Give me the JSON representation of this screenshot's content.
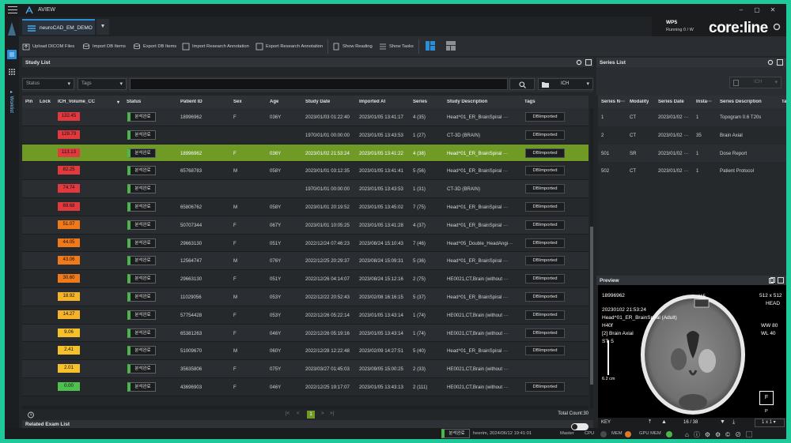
{
  "window": {
    "title": "AVIEW"
  },
  "project": {
    "name": "neuroCAD_EM_DEMO"
  },
  "wp5": {
    "title": "WP5",
    "status_text": "Running 0 / W",
    "brand_text": "core:line"
  },
  "toolbar": {
    "upload": "Upload DICOM Files",
    "import_db": "Import DB Items",
    "export_db": "Export DB Items",
    "import_research": "Import Research Annotation",
    "export_research": "Export Research Annotation",
    "show_reading": "Show Reading",
    "show_tasks": "Show Tasks"
  },
  "study_list": {
    "title": "Study List",
    "filters": {
      "status": "Status",
      "tags": "Tags",
      "search_value": "",
      "view_mode": "ICH"
    },
    "columns": {
      "pin": "Pin",
      "lock": "Lock",
      "ich": "ICH_Volume_CC",
      "status": "Status",
      "patient_id": "Patient ID",
      "sex": "Sex",
      "age": "Age",
      "study_date": "Study Date",
      "imported_at": "Imported At",
      "series": "Series",
      "description": "Study Description",
      "tags": "Tags"
    },
    "rows": [
      {
        "ich": "132.45",
        "color": "#e0393e",
        "status": "분석완료",
        "patient_id": "18996962",
        "sex": "F",
        "age": "036Y",
        "study_date": "2023/01/03 01:22:40",
        "imported_at": "2023/01/05 13:41:17",
        "series": "4 (35)",
        "description": "Head^01_ER_BrainSpiral ···",
        "tag": "DBImported"
      },
      {
        "ich": "129.79",
        "color": "#e0393e",
        "status": "분석완료",
        "patient_id": "",
        "sex": "",
        "age": "",
        "study_date": "1970/01/01 00:00:00",
        "imported_at": "2023/01/05 13:43:53",
        "series": "1 (27)",
        "description": "CT-3D (BRAIN)",
        "tag": "DBImported"
      },
      {
        "ich": "113.13",
        "color": "#e0393e",
        "status": "분석완료",
        "patient_id": "18996962",
        "sex": "F",
        "age": "036Y",
        "study_date": "2023/01/02 21:53:24",
        "imported_at": "2023/01/05 13:41:22",
        "series": "4 (38)",
        "description": "Head^01_ER_BrainSpiral ···",
        "tag": "DBImported",
        "selected": true
      },
      {
        "ich": "82.25",
        "color": "#e0393e",
        "status": "분석완료",
        "patient_id": "65768783",
        "sex": "M",
        "age": "058Y",
        "study_date": "2023/01/01 03:12:35",
        "imported_at": "2023/01/05 13:41:41",
        "series": "5 (56)",
        "description": "Head^01_ER_BrainSpiral ···",
        "tag": "DBImported"
      },
      {
        "ich": "74.74",
        "color": "#e0393e",
        "status": "분석완료",
        "patient_id": "",
        "sex": "",
        "age": "",
        "study_date": "1970/01/01 00:00:00",
        "imported_at": "2023/01/05 13:43:53",
        "series": "1 (31)",
        "description": "CT-3D (BRAIN)",
        "tag": "DBImported"
      },
      {
        "ich": "69.68",
        "color": "#e0393e",
        "status": "분석완료",
        "patient_id": "65806762",
        "sex": "M",
        "age": "058Y",
        "study_date": "2023/01/01 20:19:52",
        "imported_at": "2023/01/05 13:45:02",
        "series": "7 (75)",
        "description": "Head^01_ER_BrainSpiral ···",
        "tag": "DBImported"
      },
      {
        "ich": "51.07",
        "color": "#f07a1a",
        "status": "분석완료",
        "patient_id": "50707344",
        "sex": "F",
        "age": "067Y",
        "study_date": "2023/01/01 10:05:25",
        "imported_at": "2023/01/05 13:41:28",
        "series": "4 (37)",
        "description": "Head^01_ER_BrainSpiral ···",
        "tag": "DBImported"
      },
      {
        "ich": "44.05",
        "color": "#f07a1a",
        "status": "분석완료",
        "patient_id": "29663130",
        "sex": "F",
        "age": "051Y",
        "study_date": "2022/12/24 07:46:23",
        "imported_at": "2023/08/24 15:10:43",
        "series": "7 (46)",
        "description": "Head^05_Double_HeadAngi···",
        "tag": "DBImported"
      },
      {
        "ich": "43.06",
        "color": "#f07a1a",
        "status": "분석완료",
        "patient_id": "12564747",
        "sex": "M",
        "age": "076Y",
        "study_date": "2022/12/25 20:29:37",
        "imported_at": "2023/08/24 15:09:31",
        "series": "5 (36)",
        "description": "Head^01_ER_BrainSpiral ···",
        "tag": "DBImported"
      },
      {
        "ich": "30.60",
        "color": "#f07a1a",
        "status": "분석완료",
        "patient_id": "29663130",
        "sex": "F",
        "age": "051Y",
        "study_date": "2022/12/26 04:14:07",
        "imported_at": "2023/08/24 15:12:16",
        "series": "2 (75)",
        "description": "HE0021,CT,Brain (without ···",
        "tag": "DBImported"
      },
      {
        "ich": "18.92",
        "color": "#f5b32a",
        "status": "분석완료",
        "patient_id": "11029056",
        "sex": "M",
        "age": "053Y",
        "study_date": "2022/12/22 20:52:43",
        "imported_at": "2023/02/08 16:16:15",
        "series": "5 (37)",
        "description": "Head^01_ER_BrainSpiral ···",
        "tag": "DBImported"
      },
      {
        "ich": "14.27",
        "color": "#f5b32a",
        "status": "분석완료",
        "patient_id": "57754428",
        "sex": "F",
        "age": "053Y",
        "study_date": "2022/12/26 05:22:14",
        "imported_at": "2023/01/05 13:43:14",
        "series": "1 (74)",
        "description": "HE0021,CT,Brain (without ···",
        "tag": "DBImported"
      },
      {
        "ich": "9.06",
        "color": "#f5c02a",
        "status": "분석완료",
        "patient_id": "65381263",
        "sex": "F",
        "age": "046Y",
        "study_date": "2022/12/26 05:19:16",
        "imported_at": "2023/01/05 13:43:14",
        "series": "1 (74)",
        "description": "HE0021,CT,Brain (without ···",
        "tag": "DBImported"
      },
      {
        "ich": "2.41",
        "color": "#f5c02a",
        "status": "분석완료",
        "patient_id": "51009670",
        "sex": "M",
        "age": "060Y",
        "study_date": "2022/12/28 12:22:48",
        "imported_at": "2023/02/09 14:27:51",
        "series": "5 (40)",
        "description": "Head^01_ER_BrainSpiral ···",
        "tag": "DBImported"
      },
      {
        "ich": "2.01",
        "color": "#f5c02a",
        "status": "분석완료",
        "patient_id": "35635806",
        "sex": "F",
        "age": "075Y",
        "study_date": "2023/03/27 01:45:03",
        "imported_at": "2023/09/05 15:00:25",
        "series": "2 (33)",
        "description": "HE0021,CT,Brain (without ···",
        "tag": ""
      },
      {
        "ich": "0.00",
        "color": "#4fbf4f",
        "status": "분석완료",
        "patient_id": "43696903",
        "sex": "F",
        "age": "046Y",
        "study_date": "2022/12/25 19:17:07",
        "imported_at": "2023/01/05 13:43:13",
        "series": "2 (111)",
        "description": "HE0021,CT,Brain (without ···",
        "tag": "DBImported"
      }
    ],
    "pager": {
      "current_page": "1",
      "first": "|<",
      "prev": "<",
      "next": ">",
      "last": ">|"
    },
    "total_count": "Total Count:30"
  },
  "related": {
    "title": "Related Exam List"
  },
  "series_list": {
    "title": "Series List",
    "view_mode": "ICH",
    "columns": {
      "num": "Series N···",
      "modality": "Modality",
      "date": "Series Date",
      "instance": "Insta···",
      "description": "Series Description",
      "ta": "Ta"
    },
    "rows": [
      {
        "num": "1",
        "modality": "CT",
        "date": "2023/01/02 ···",
        "instance": "1",
        "description": "Topogram  0.6  T20s"
      },
      {
        "num": "2",
        "modality": "CT",
        "date": "2023/01/02 ···",
        "instance": "35",
        "description": "Brain Axial"
      },
      {
        "num": "501",
        "modality": "SR",
        "date": "2023/01/02 ···",
        "instance": "1",
        "description": "Dose Report"
      },
      {
        "num": "502",
        "modality": "CT",
        "date": "2023/01/02 ···",
        "instance": "1",
        "description": "Patient Protocol"
      }
    ]
  },
  "preview": {
    "title": "Preview",
    "patient_id": "18996962",
    "datetime": "20230102 21:53:24",
    "study": "Head^01_ER_BrainSpiral (Adult)",
    "kernel": "H40f",
    "series": "[2] Brain Axial",
    "slice": "ST: 5",
    "frame_label": "#15",
    "matrix": "512 x 512",
    "position": "HEAD",
    "ww": "WW   80",
    "wl": "WL   40",
    "scale": "6.2 cm",
    "orient_f": "F",
    "orient_p": "P",
    "key_label": "KEY",
    "frame_counter": "16 / 38",
    "layout": "1 x 1"
  },
  "statusbar": {
    "status": "분석완료",
    "user_info": "heerim, 2024/06/12 19:41:01",
    "master": "Master",
    "cpu": "CPU",
    "mem": "MEM",
    "gpu_mem": "GPU MEM"
  }
}
